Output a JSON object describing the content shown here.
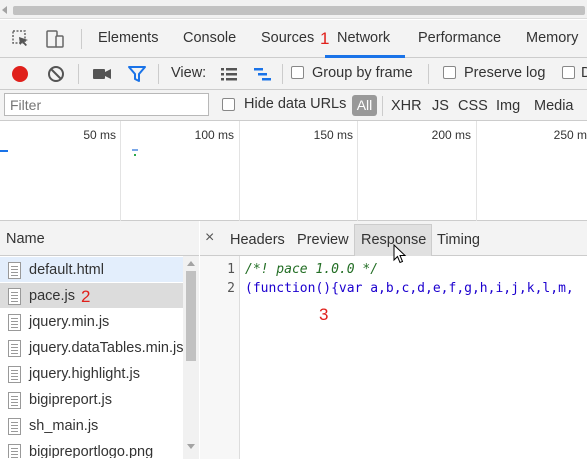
{
  "devtools": {
    "tabs": [
      "Elements",
      "Console",
      "Sources",
      "Network",
      "Performance",
      "Memory"
    ],
    "active_tab": "Network"
  },
  "toolbar": {
    "view_label": "View:",
    "group_by_frame": "Group by frame",
    "preserve_log": "Preserve log",
    "disable_cache_partial": "D"
  },
  "filter": {
    "placeholder": "Filter",
    "hide_data_urls": "Hide data URLs",
    "types": [
      "All",
      "XHR",
      "JS",
      "CSS",
      "Img",
      "Media"
    ]
  },
  "timeline": {
    "ticks": [
      "50 ms",
      "100 ms",
      "150 ms",
      "200 ms",
      "250 m"
    ]
  },
  "requests": {
    "header": "Name",
    "files": [
      "default.html",
      "pace.js",
      "jquery.min.js",
      "jquery.dataTables.min.js",
      "jquery.highlight.js",
      "bigipreport.js",
      "sh_main.js",
      "bigipreportlogo.png"
    ],
    "selected": "pace.js"
  },
  "detail": {
    "close": "×",
    "tabs": [
      "Headers",
      "Preview",
      "Response",
      "Timing"
    ],
    "active_tab": "Response",
    "lines": [
      {
        "no": "1",
        "text": "/*! pace 1.0.0 */"
      },
      {
        "no": "2",
        "text": "(function(){var a,b,c,d,e,f,g,h,i,j,k,l,m,"
      }
    ]
  },
  "annotations": [
    "1",
    "2",
    "3"
  ],
  "colors": {
    "record": "#e0201b",
    "filter_icon": "#1a73e8",
    "tab_underline": "#1a73e8",
    "selected_row": "#dcdcdc",
    "highlight_row": "#e3eefc",
    "annotation": "#e0201b"
  }
}
